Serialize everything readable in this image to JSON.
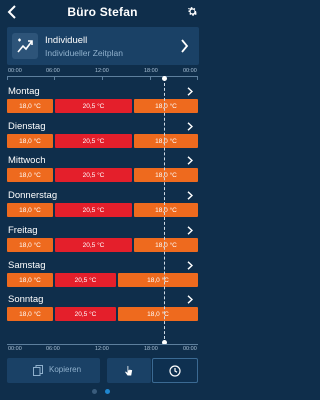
{
  "header": {
    "title": "Büro Stefan",
    "back_icon": "chevron-left-icon",
    "settings_icon": "gear-icon"
  },
  "schedule": {
    "name": "Individuell",
    "subtitle": "Individueller Zeitplan",
    "icon": "custom-schedule-icon"
  },
  "timeline": {
    "ticks": [
      "00:00",
      "06:00",
      "12:00",
      "18:00",
      "00:00"
    ]
  },
  "days": [
    {
      "name": "Montag",
      "segments": [
        {
          "temp": "18,0 °C",
          "mode": "low",
          "start": 0,
          "end": 6
        },
        {
          "temp": "20,5 °C",
          "mode": "high",
          "start": 6,
          "end": 16
        },
        {
          "temp": "18,0 °C",
          "mode": "low",
          "start": 16,
          "end": 24
        }
      ]
    },
    {
      "name": "Dienstag",
      "segments": [
        {
          "temp": "18,0 °C",
          "mode": "low",
          "start": 0,
          "end": 6
        },
        {
          "temp": "20,5 °C",
          "mode": "high",
          "start": 6,
          "end": 16
        },
        {
          "temp": "18,0 °C",
          "mode": "low",
          "start": 16,
          "end": 24
        }
      ]
    },
    {
      "name": "Mittwoch",
      "segments": [
        {
          "temp": "18,0 °C",
          "mode": "low",
          "start": 0,
          "end": 6
        },
        {
          "temp": "20,5 °C",
          "mode": "high",
          "start": 6,
          "end": 16
        },
        {
          "temp": "18,0 °C",
          "mode": "low",
          "start": 16,
          "end": 24
        }
      ]
    },
    {
      "name": "Donnerstag",
      "segments": [
        {
          "temp": "18,0 °C",
          "mode": "low",
          "start": 0,
          "end": 6
        },
        {
          "temp": "20,5 °C",
          "mode": "high",
          "start": 6,
          "end": 16
        },
        {
          "temp": "18,0 °C",
          "mode": "low",
          "start": 16,
          "end": 24
        }
      ]
    },
    {
      "name": "Freitag",
      "segments": [
        {
          "temp": "18,0 °C",
          "mode": "low",
          "start": 0,
          "end": 6
        },
        {
          "temp": "20,5 °C",
          "mode": "high",
          "start": 6,
          "end": 16
        },
        {
          "temp": "18,0 °C",
          "mode": "low",
          "start": 16,
          "end": 24
        }
      ]
    },
    {
      "name": "Samstag",
      "segments": [
        {
          "temp": "18,0 °C",
          "mode": "low",
          "start": 0,
          "end": 6
        },
        {
          "temp": "20,5 °C",
          "mode": "high",
          "start": 6,
          "end": 14
        },
        {
          "temp": "18,0 °C",
          "mode": "low",
          "start": 14,
          "end": 24
        }
      ]
    },
    {
      "name": "Sonntag",
      "segments": [
        {
          "temp": "18,0 °C",
          "mode": "low",
          "start": 0,
          "end": 6
        },
        {
          "temp": "20,5 °C",
          "mode": "high",
          "start": 6,
          "end": 14
        },
        {
          "temp": "18,0 °C",
          "mode": "low",
          "start": 14,
          "end": 24
        }
      ]
    }
  ],
  "bottom": {
    "copy_label": "Kopieren",
    "copy_icon": "copy-icon",
    "touch_icon": "hand-pointer-icon",
    "clock_icon": "clock-icon"
  },
  "colors": {
    "background": "#0f2e4b",
    "low_temp": "#ee6a1e",
    "high_temp": "#e41f2b",
    "card": "#1a4166"
  }
}
